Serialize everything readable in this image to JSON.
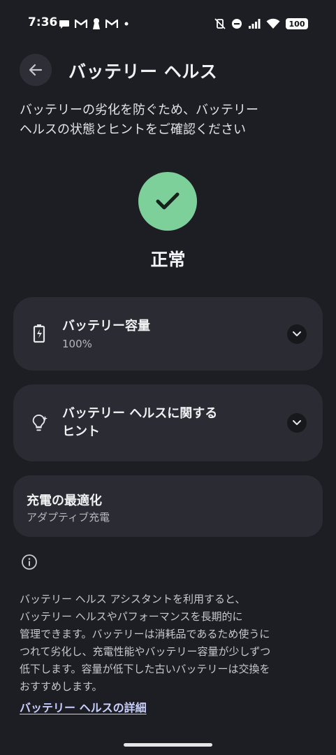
{
  "status_bar": {
    "time": "7:36",
    "battery_percent": "100",
    "left_icons": [
      "chat-bubble-icon",
      "gmail-icon",
      "keyhole-icon",
      "gmail-icon",
      "dot-icon"
    ],
    "right_icons": [
      "vibrate-off-icon",
      "do-not-disturb-icon",
      "signal-icon",
      "wifi-icon"
    ]
  },
  "header": {
    "back_icon": "arrow-left-icon",
    "title": "バッテリー ヘルス"
  },
  "description": {
    "line1": "バッテリーの劣化を防ぐため、バッテリー",
    "line2": "ヘルスの状態とヒントをご確認ください"
  },
  "health_status": {
    "icon": "checkmark-icon",
    "label": "正常",
    "color": "#7dd09a"
  },
  "cards": {
    "capacity": {
      "icon": "battery-charging-icon",
      "title": "バッテリー容量",
      "value": "100%",
      "expand_icon": "chevron-down-icon"
    },
    "tips": {
      "icon": "lightbulb-sparkle-icon",
      "title_line1": "バッテリー ヘルスに関する",
      "title_line2": "ヒント",
      "expand_icon": "chevron-down-icon"
    },
    "charge_optimization": {
      "title": "充電の最適化",
      "subtitle": "アダプティブ充電"
    }
  },
  "info": {
    "icon": "info-icon",
    "lines": [
      "バッテリー ヘルス アシスタントを利用すると、",
      "バッテリー ヘルスやパフォーマンスを長期的に",
      "管理できます。バッテリーは消耗品であるため使うに",
      "つれて劣化し、充電性能やバッテリー容量が少しずつ",
      "低下します。容量が低下した古いバッテリーは交換を",
      "おすすめします。"
    ],
    "link": "バッテリー ヘルスの詳細"
  }
}
